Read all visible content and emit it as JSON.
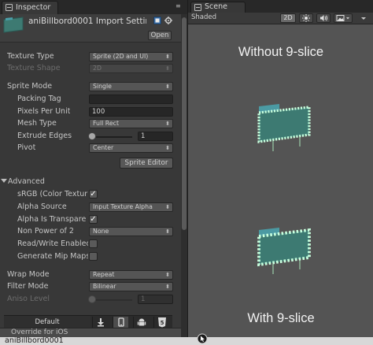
{
  "inspector": {
    "tab_label": "Inspector",
    "asset_title": "aniBillbord0001 Import Settin",
    "open_label": "Open",
    "texture_type": {
      "label": "Texture Type",
      "value": "Sprite (2D and UI)"
    },
    "texture_shape": {
      "label": "Texture Shape",
      "value": "2D"
    },
    "sprite_mode": {
      "label": "Sprite Mode",
      "value": "Single"
    },
    "packing_tag": {
      "label": "Packing Tag",
      "value": ""
    },
    "pixels_per_unit": {
      "label": "Pixels Per Unit",
      "value": "100"
    },
    "mesh_type": {
      "label": "Mesh Type",
      "value": "Full Rect"
    },
    "extrude_edges": {
      "label": "Extrude Edges",
      "value": "1"
    },
    "pivot": {
      "label": "Pivot",
      "value": "Center"
    },
    "sprite_editor_label": "Sprite Editor",
    "advanced_label": "Advanced",
    "srgb": {
      "label": "sRGB (Color Textur",
      "checked": true
    },
    "alpha_source": {
      "label": "Alpha Source",
      "value": "Input Texture Alpha"
    },
    "alpha_transparency": {
      "label": "Alpha Is Transpare",
      "checked": true
    },
    "non_power_of_2": {
      "label": "Non Power of 2",
      "value": "None"
    },
    "read_write": {
      "label": "Read/Write Enablec",
      "checked": false
    },
    "mip_maps": {
      "label": "Generate Mip Maps",
      "checked": false
    },
    "wrap_mode": {
      "label": "Wrap Mode",
      "value": "Repeat"
    },
    "filter_mode": {
      "label": "Filter Mode",
      "value": "Bilinear"
    },
    "aniso_level": {
      "label": "Aniso Level",
      "value": "1"
    },
    "platform_default": "Default",
    "override_label": "Override for iOS",
    "footer_title": "aniBillbord0001"
  },
  "scene": {
    "tab_label": "Scene",
    "shading_mode": "Shaded",
    "mode_2d_label": "2D",
    "title_top": "Without 9-slice",
    "title_bottom": "With 9-slice"
  },
  "colors": {
    "accent_teal": "#3d8c95",
    "bulb": "#b9ffd4",
    "board": "#3d7a72"
  },
  "icons": [
    "inspector-icon",
    "menu-icon",
    "help-icon",
    "settings-icon",
    "dropdown-arrow-icon",
    "checkmark-icon",
    "download-icon",
    "phone-icon",
    "android-icon",
    "html5-icon",
    "scene-icon",
    "sun-icon",
    "audio-icon",
    "image-icon",
    "chevron-down-icon",
    "cursor-icon"
  ]
}
